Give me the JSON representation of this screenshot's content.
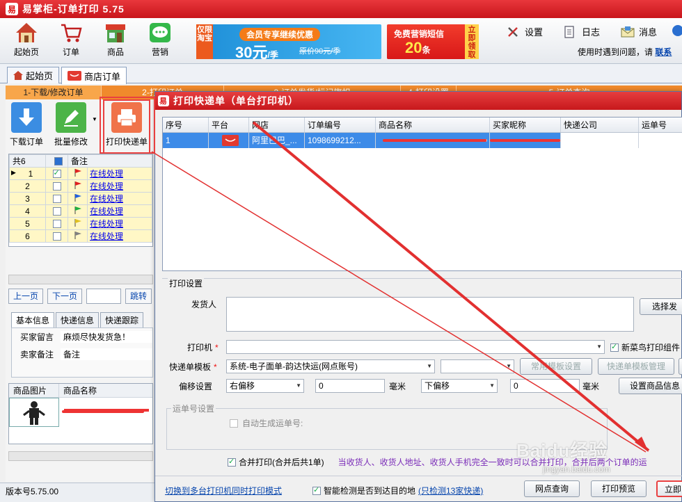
{
  "app": {
    "title": "易掌柜-订单打印 5.75",
    "logo_char": "易"
  },
  "toolbar": {
    "buttons": [
      {
        "label": "起始页"
      },
      {
        "label": "订单"
      },
      {
        "label": "商品"
      },
      {
        "label": "营销"
      }
    ],
    "banner1": {
      "tag": "仅限淘宝",
      "pill": "会员专享继续优惠",
      "price": "30元",
      "unit": "/季",
      "orig": "原价90元/季"
    },
    "banner2": {
      "title": "免费营销短信",
      "count": "20",
      "unit": "条",
      "tag": "立即领取"
    },
    "links": [
      {
        "label": "设置"
      },
      {
        "label": "日志"
      },
      {
        "label": "消息"
      }
    ],
    "help_text": "使用时遇到问题，请",
    "help_link": "联系"
  },
  "main_tabs": [
    {
      "label": "起始页"
    },
    {
      "label": "商店订单"
    }
  ],
  "steps": [
    "1-下载/修改订单",
    "2-打印订单",
    "3-订单发货/标记旗帜",
    "4-打印设置",
    "5-订单查询"
  ],
  "left": {
    "buttons": [
      {
        "label": "下载订单"
      },
      {
        "label": "批量修改"
      },
      {
        "label": "打印快递单"
      }
    ],
    "grid": {
      "count_label": "共6",
      "note_header": "备注",
      "rows": [
        {
          "num": "1",
          "checked": true,
          "flag": "#e02020",
          "action": "在线处理"
        },
        {
          "num": "2",
          "checked": false,
          "flag": "#e02020",
          "action": "在线处理"
        },
        {
          "num": "3",
          "checked": false,
          "flag": "#2060e0",
          "action": "在线处理"
        },
        {
          "num": "4",
          "checked": false,
          "flag": "#20b040",
          "action": "在线处理"
        },
        {
          "num": "5",
          "checked": false,
          "flag": "#e0c020",
          "action": "在线处理"
        },
        {
          "num": "6",
          "checked": false,
          "flag": "#808080",
          "action": "在线处理"
        }
      ]
    },
    "pager": {
      "prev": "上一页",
      "next": "下一页",
      "jump": "跳转"
    },
    "subtabs": [
      "基本信息",
      "快递信息",
      "快递跟踪"
    ],
    "info": {
      "buyer_msg_label": "买家留言",
      "buyer_msg": "麻烦尽快发货急！",
      "seller_note_label": "卖家备注",
      "seller_note": "备注"
    },
    "goods": {
      "col_img": "商品图片",
      "col_name": "商品名称"
    },
    "version": "版本号5.75.00"
  },
  "dialog": {
    "title": "打印快递单（单台打印机）",
    "columns": [
      "序号",
      "平台",
      "网店",
      "订单编号",
      "商品名称",
      "买家昵称",
      "快递公司",
      "运单号"
    ],
    "row": {
      "num": "1",
      "shop": "阿里巴巴_...",
      "order_no": "1098699212..."
    },
    "settings": {
      "legend": "打印设置",
      "sender_label": "发货人",
      "select_sender_btn": "选择发",
      "printer_label": "打印机",
      "printer_value": "",
      "cainiao_label": "新菜鸟打印组件",
      "template_label": "快递单模板",
      "template_value": "系统-电子面单-韵达快运(网点账号)",
      "common_template_btn": "常用模板设置",
      "template_manage_btn": "快递单模板管理",
      "offset_label": "偏移设置",
      "offset_h_dir": "右偏移",
      "offset_h_val": "0",
      "unit1": "毫米",
      "offset_v_dir": "下偏移",
      "offset_v_val": "0",
      "unit2": "毫米",
      "goods_info_btn": "设置商品信息",
      "waybill_legend": "运单号设置",
      "auto_gen_label": "自动生成运单号:"
    },
    "merge": {
      "label": "合并打印(合并后共1单",
      "close": ")",
      "note": "当收货人、收货人地址、收货人手机完全一致时可以合并打印，合并后两个订单的运"
    },
    "footer": {
      "switch_link": "切换到多台打印机同时打印模式",
      "smart_check": "智能检测是否到达目的地",
      "only_check": "(只检测13家快递)",
      "btn_query": "网点查询",
      "btn_preview": "打印预览",
      "btn_print": "立即"
    }
  },
  "watermark": {
    "main": "Baidu经验",
    "sub": "jingyan.baidu.com"
  }
}
